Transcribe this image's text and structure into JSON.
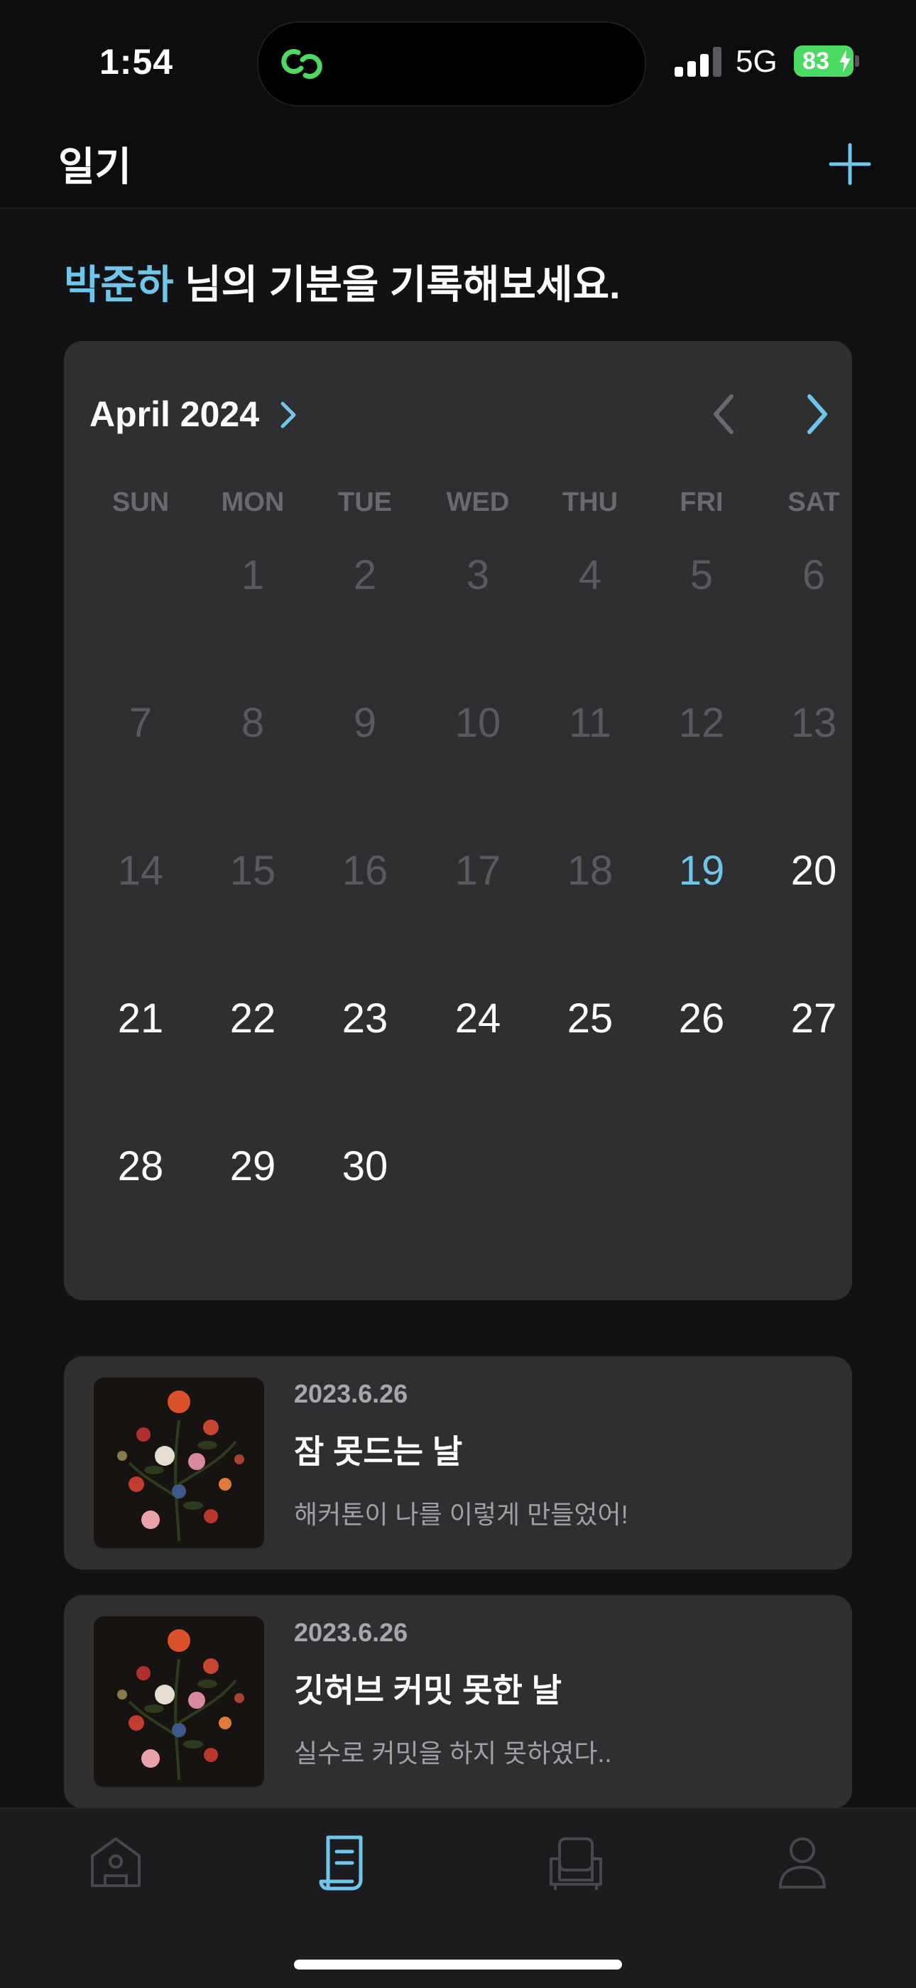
{
  "status_bar": {
    "time": "1:54",
    "network": "5G",
    "battery": "83"
  },
  "header": {
    "title": "일기",
    "add_icon": "plus-icon"
  },
  "greeting": {
    "user_name": "박준하",
    "message": " 님의 기분을 기록해보세요."
  },
  "calendar": {
    "month_label": "April 2024",
    "weekdays": [
      "SUN",
      "MON",
      "TUE",
      "WED",
      "THU",
      "FRI",
      "SAT"
    ],
    "today": 19,
    "first_weekday_index": 1,
    "days_in_month": 30,
    "colors": {
      "accent": "#6ec6ea",
      "past": "#5a5a5e",
      "future": "#ffffff"
    }
  },
  "entries": [
    {
      "date": "2023.6.26",
      "title": "잠 못드는 날",
      "preview": "해커톤이 나를 이렇게 만들었어!"
    },
    {
      "date": "2023.6.26",
      "title": "깃허브 커밋 못한 날",
      "preview": "실수로 커밋을 하지 못하였다.."
    }
  ],
  "tab_bar": {
    "tabs": [
      "home-icon",
      "diary-icon",
      "chair-icon",
      "profile-icon"
    ],
    "active": "diary-icon"
  }
}
